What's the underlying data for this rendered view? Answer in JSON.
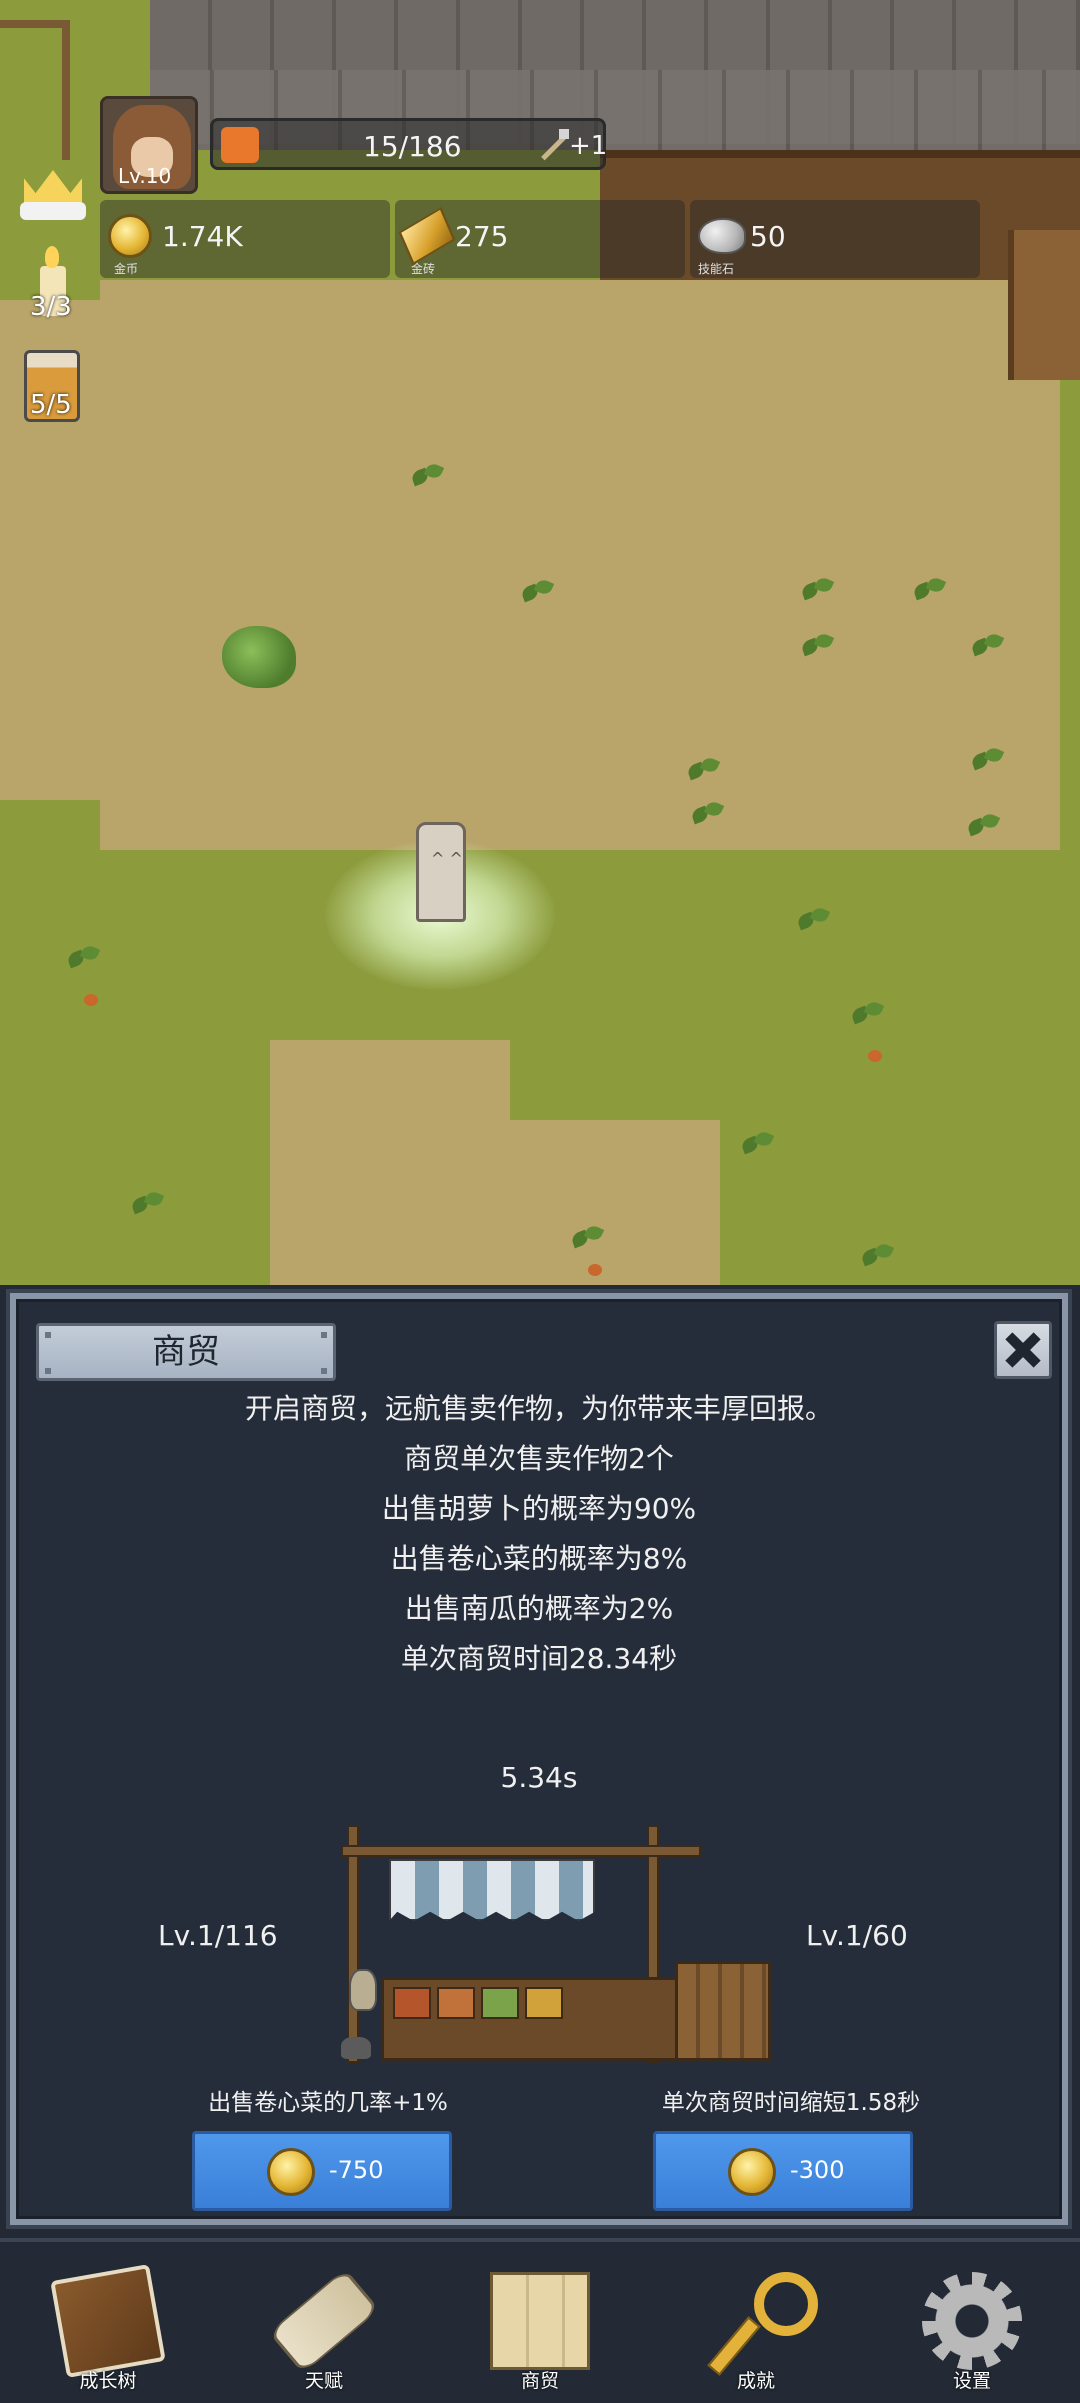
{
  "hud": {
    "player_level": "Lv.10",
    "xp_text": "15/186",
    "xp_bonus": "+1",
    "resources": [
      {
        "icon": "coin-icon",
        "value": "1.74K",
        "caption": "金币"
      },
      {
        "icon": "gold-bar-icon",
        "value": "275",
        "caption": "金砖"
      },
      {
        "icon": "skill-stone-icon",
        "value": "50",
        "caption": "技能石"
      }
    ],
    "side": {
      "candle_count": "3/3",
      "mug_count": "5/5"
    }
  },
  "panel": {
    "title": "商贸",
    "description": [
      "开启商贸，远航售卖作物，为你带来丰厚回报。",
      "商贸单次售卖作物2个",
      "出售胡萝卜的概率为90%",
      "出售卷心菜的概率为8%",
      "出售南瓜的概率为2%",
      "单次商贸时间28.34秒"
    ],
    "timer": "5.34s",
    "upgrades": [
      {
        "level": "Lv.1/116",
        "description": "出售卷心菜的几率+1%",
        "cost": "-750"
      },
      {
        "level": "Lv.1/60",
        "description": "单次商贸时间缩短1.58秒",
        "cost": "-300"
      }
    ]
  },
  "nav": [
    {
      "icon": "book-icon",
      "label": "成长树"
    },
    {
      "icon": "scroll-icon",
      "label": "天赋"
    },
    {
      "icon": "map-icon",
      "label": "商贸"
    },
    {
      "icon": "key-icon",
      "label": "成就"
    },
    {
      "icon": "gear-icon",
      "label": "设置"
    }
  ],
  "colors": {
    "panel_bg": "#262d3a",
    "button_blue": "#4a90e2",
    "grass": "#8c9b3c",
    "dirt": "#b9a56a"
  }
}
